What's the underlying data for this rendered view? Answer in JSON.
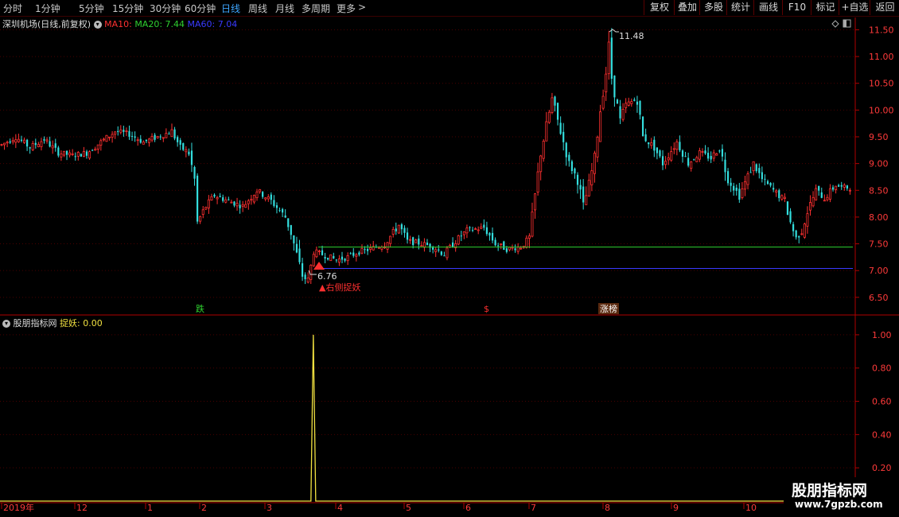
{
  "toolbar": {
    "periods": [
      "分时",
      "1分钟",
      "5分钟",
      "15分钟",
      "30分钟",
      "60分钟",
      "日线",
      "周线",
      "月线",
      "多周期",
      "更多"
    ],
    "active_period": "日线",
    "more_arrow": ">",
    "right_buttons": [
      "复权",
      "叠加",
      "多股",
      "统计",
      "画线",
      "F10",
      "标记",
      "+自选",
      "返回"
    ]
  },
  "main_legend": {
    "title": "深圳机场(日线,前复权)",
    "ma10": "MA10:",
    "ma20": "MA20: 7.44",
    "ma60": "MA60: 7.04",
    "ma10_color": "#ff3030",
    "ma20_color": "#2fd02f",
    "ma60_color": "#3a3aff"
  },
  "indicator_legend": {
    "name": "股朋指标网",
    "value_label": "捉妖: 0.00",
    "value_color": "#f0e040"
  },
  "annotations": {
    "high": "11.48",
    "low": "6.76",
    "signal": "▲右侧捉妖",
    "event_die": "跌",
    "event_dollar": "$",
    "event_zhangting": "涨榜"
  },
  "colors": {
    "up": "#ff3030",
    "down": "#33dddd",
    "axis": "#b00000",
    "ind_line": "#f0e040"
  },
  "watermark": {
    "line1": "股朋指标网",
    "line2": "www.7gpzb.com"
  },
  "chart_data": [
    {
      "type": "candlestick",
      "title": "深圳机场(日线,前复权)",
      "ylim": [
        6.2,
        11.7
      ],
      "yticks": [
        "11.50",
        "11.00",
        "10.50",
        "10.00",
        "9.50",
        "9.00",
        "8.50",
        "8.00",
        "7.50",
        "7.00",
        "6.50"
      ],
      "x_labels": [
        "2019年",
        "12",
        "1",
        "2",
        "3",
        "4",
        "5",
        "6",
        "7",
        "8",
        "9",
        "10"
      ],
      "series": [
        {
          "name": "MA20",
          "level": 7.44
        },
        {
          "name": "MA60",
          "level": 7.04
        }
      ],
      "close_path": [
        [
          0,
          9.35
        ],
        [
          5,
          9.5
        ],
        [
          10,
          9.3
        ],
        [
          15,
          9.45
        ],
        [
          20,
          9.2
        ],
        [
          25,
          9.15
        ],
        [
          30,
          9.2
        ],
        [
          35,
          9.4
        ],
        [
          40,
          9.6
        ],
        [
          45,
          9.55
        ],
        [
          50,
          9.4
        ],
        [
          55,
          9.5
        ],
        [
          60,
          9.6
        ],
        [
          63,
          9.3
        ],
        [
          66,
          9.2
        ],
        [
          68,
          8.7
        ],
        [
          69,
          7.9
        ],
        [
          72,
          8.2
        ],
        [
          75,
          8.4
        ],
        [
          80,
          8.3
        ],
        [
          85,
          8.2
        ],
        [
          90,
          8.5
        ],
        [
          95,
          8.3
        ],
        [
          100,
          8.0
        ],
        [
          102,
          7.7
        ],
        [
          104,
          7.3
        ],
        [
          106,
          6.9
        ],
        [
          108,
          6.8
        ],
        [
          110,
          7.35
        ],
        [
          113,
          7.3
        ],
        [
          118,
          7.2
        ],
        [
          122,
          7.25
        ],
        [
          126,
          7.35
        ],
        [
          130,
          7.4
        ],
        [
          135,
          7.5
        ],
        [
          140,
          7.85
        ],
        [
          143,
          7.55
        ],
        [
          148,
          7.5
        ],
        [
          152,
          7.45
        ],
        [
          156,
          7.3
        ],
        [
          160,
          7.55
        ],
        [
          164,
          7.75
        ],
        [
          170,
          7.8
        ],
        [
          174,
          7.5
        ],
        [
          178,
          7.4
        ],
        [
          183,
          7.45
        ],
        [
          186,
          7.6
        ],
        [
          188,
          8.4
        ],
        [
          190,
          9.2
        ],
        [
          192,
          9.7
        ],
        [
          194,
          10.2
        ],
        [
          197,
          9.6
        ],
        [
          200,
          9.0
        ],
        [
          203,
          8.7
        ],
        [
          205,
          8.2
        ],
        [
          207,
          8.6
        ],
        [
          209,
          9.1
        ],
        [
          211,
          10.0
        ],
        [
          213,
          10.7
        ],
        [
          214,
          11.2
        ],
        [
          215,
          10.6
        ],
        [
          218,
          9.8
        ],
        [
          220,
          10.1
        ],
        [
          224,
          10.2
        ],
        [
          226,
          9.5
        ],
        [
          230,
          9.3
        ],
        [
          233,
          9.0
        ],
        [
          238,
          9.4
        ],
        [
          242,
          9.0
        ],
        [
          246,
          9.2
        ],
        [
          250,
          9.1
        ],
        [
          253,
          9.3
        ],
        [
          256,
          8.7
        ],
        [
          260,
          8.4
        ],
        [
          265,
          9.0
        ],
        [
          268,
          8.7
        ],
        [
          272,
          8.5
        ],
        [
          276,
          8.3
        ],
        [
          278,
          7.9
        ],
        [
          280,
          7.6
        ],
        [
          282,
          7.75
        ],
        [
          284,
          8.1
        ],
        [
          287,
          8.5
        ],
        [
          290,
          8.35
        ],
        [
          294,
          8.6
        ],
        [
          296,
          8.55
        ]
      ],
      "annotations": {
        "high": "11.48",
        "low": "6.76",
        "signal": "▲右侧捉妖"
      }
    },
    {
      "type": "line",
      "name": "捉妖",
      "ylim": [
        0,
        1.1
      ],
      "yticks": [
        "1.00",
        "0.80",
        "0.60",
        "0.40",
        "0.20"
      ],
      "values": [
        {
          "x": 110,
          "y": 1.0
        }
      ],
      "baseline": 0
    }
  ]
}
